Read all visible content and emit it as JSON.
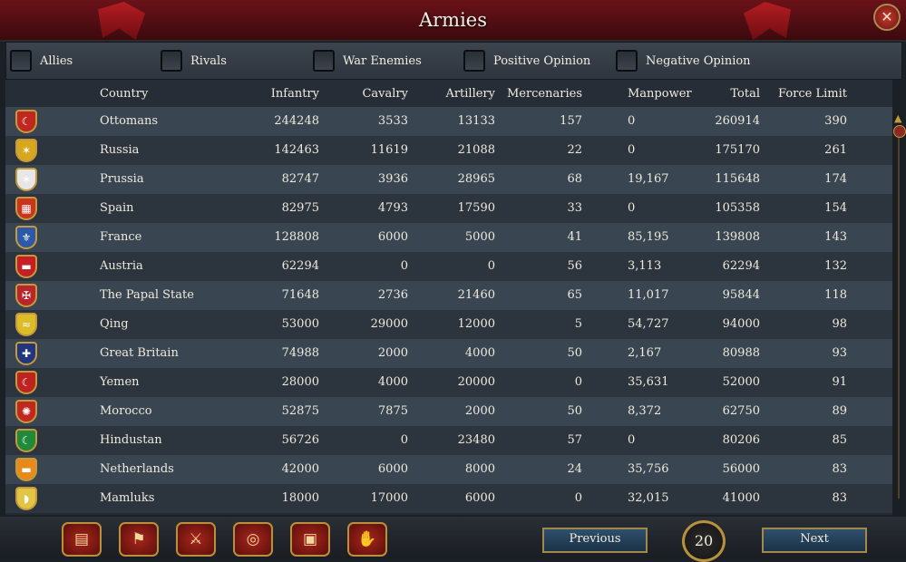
{
  "window": {
    "title": "Armies",
    "close_label": "✕"
  },
  "filters": [
    {
      "label": "Allies"
    },
    {
      "label": "Rivals"
    },
    {
      "label": "War Enemies"
    },
    {
      "label": "Positive Opinion"
    },
    {
      "label": "Negative Opinion"
    }
  ],
  "columns": {
    "country": "Country",
    "infantry": "Infantry",
    "cavalry": "Cavalry",
    "artillery": "Artillery",
    "mercenaries": "Mercenaries",
    "manpower": "Manpower",
    "total": "Total",
    "force_limit": "Force Limit"
  },
  "rows": [
    {
      "country": "Ottomans",
      "infantry": "244248",
      "cavalry": "3533",
      "artillery": "13133",
      "mercenaries": "157",
      "manpower": "0",
      "total": "260914",
      "force_limit": "390",
      "flag_color": "#c0271f",
      "flag_icon": "☾"
    },
    {
      "country": "Russia",
      "infantry": "142463",
      "cavalry": "11619",
      "artillery": "21088",
      "mercenaries": "22",
      "manpower": "0",
      "total": "175170",
      "force_limit": "261",
      "flag_color": "#d7a81e",
      "flag_icon": "✶"
    },
    {
      "country": "Prussia",
      "infantry": "82747",
      "cavalry": "3936",
      "artillery": "28965",
      "mercenaries": "68",
      "manpower": "19,167",
      "total": "115648",
      "force_limit": "174",
      "flag_color": "#e7e7e7",
      "flag_icon": "✶"
    },
    {
      "country": "Spain",
      "infantry": "82975",
      "cavalry": "4793",
      "artillery": "17590",
      "mercenaries": "33",
      "manpower": "0",
      "total": "105358",
      "force_limit": "154",
      "flag_color": "#c8361e",
      "flag_icon": "▦"
    },
    {
      "country": "France",
      "infantry": "128808",
      "cavalry": "6000",
      "artillery": "5000",
      "mercenaries": "41",
      "manpower": "85,195",
      "total": "139808",
      "force_limit": "143",
      "flag_color": "#2c5aa8",
      "flag_icon": "⚜"
    },
    {
      "country": "Austria",
      "infantry": "62294",
      "cavalry": "0",
      "artillery": "0",
      "mercenaries": "56",
      "manpower": "3,113",
      "total": "62294",
      "force_limit": "132",
      "flag_color": "#c51f24",
      "flag_icon": "▬"
    },
    {
      "country": "The Papal State",
      "infantry": "71648",
      "cavalry": "2736",
      "artillery": "21460",
      "mercenaries": "65",
      "manpower": "11,017",
      "total": "95844",
      "force_limit": "118",
      "flag_color": "#b8262a",
      "flag_icon": "✠"
    },
    {
      "country": "Qing",
      "infantry": "53000",
      "cavalry": "29000",
      "artillery": "12000",
      "mercenaries": "5",
      "manpower": "54,727",
      "total": "94000",
      "force_limit": "98",
      "flag_color": "#dcbc27",
      "flag_icon": "≈"
    },
    {
      "country": "Great Britain",
      "infantry": "74988",
      "cavalry": "2000",
      "artillery": "4000",
      "mercenaries": "50",
      "manpower": "2,167",
      "total": "80988",
      "force_limit": "93",
      "flag_color": "#22367f",
      "flag_icon": "✚"
    },
    {
      "country": "Yemen",
      "infantry": "28000",
      "cavalry": "4000",
      "artillery": "20000",
      "mercenaries": "0",
      "manpower": "35,631",
      "total": "52000",
      "force_limit": "91",
      "flag_color": "#bd2420",
      "flag_icon": "☾"
    },
    {
      "country": "Morocco",
      "infantry": "52875",
      "cavalry": "7875",
      "artillery": "2000",
      "mercenaries": "50",
      "manpower": "8,372",
      "total": "62750",
      "force_limit": "89",
      "flag_color": "#c0281f",
      "flag_icon": "✺"
    },
    {
      "country": "Hindustan",
      "infantry": "56726",
      "cavalry": "0",
      "artillery": "23480",
      "mercenaries": "57",
      "manpower": "0",
      "total": "80206",
      "force_limit": "85",
      "flag_color": "#1f8a3a",
      "flag_icon": "☾"
    },
    {
      "country": "Netherlands",
      "infantry": "42000",
      "cavalry": "6000",
      "artillery": "8000",
      "mercenaries": "24",
      "manpower": "35,756",
      "total": "56000",
      "force_limit": "83",
      "flag_color": "#e88a1a",
      "flag_icon": "▬"
    },
    {
      "country": "Mamluks",
      "infantry": "18000",
      "cavalry": "17000",
      "artillery": "6000",
      "mercenaries": "0",
      "manpower": "32,015",
      "total": "41000",
      "force_limit": "83",
      "flag_color": "#e3c443",
      "flag_icon": "◗"
    }
  ],
  "bottom_tabs": [
    {
      "icon": "scroll-icon",
      "glyph": "▤"
    },
    {
      "icon": "flag-icon",
      "glyph": "⚑"
    },
    {
      "icon": "crossed-swords-icon",
      "glyph": "⚔"
    },
    {
      "icon": "coins-icon",
      "glyph": "◎"
    },
    {
      "icon": "trade-goods-icon",
      "glyph": "▣"
    },
    {
      "icon": "handshake-icon",
      "glyph": "✋"
    }
  ],
  "pagination": {
    "previous_label": "Previous",
    "next_label": "Next",
    "page": "20"
  }
}
